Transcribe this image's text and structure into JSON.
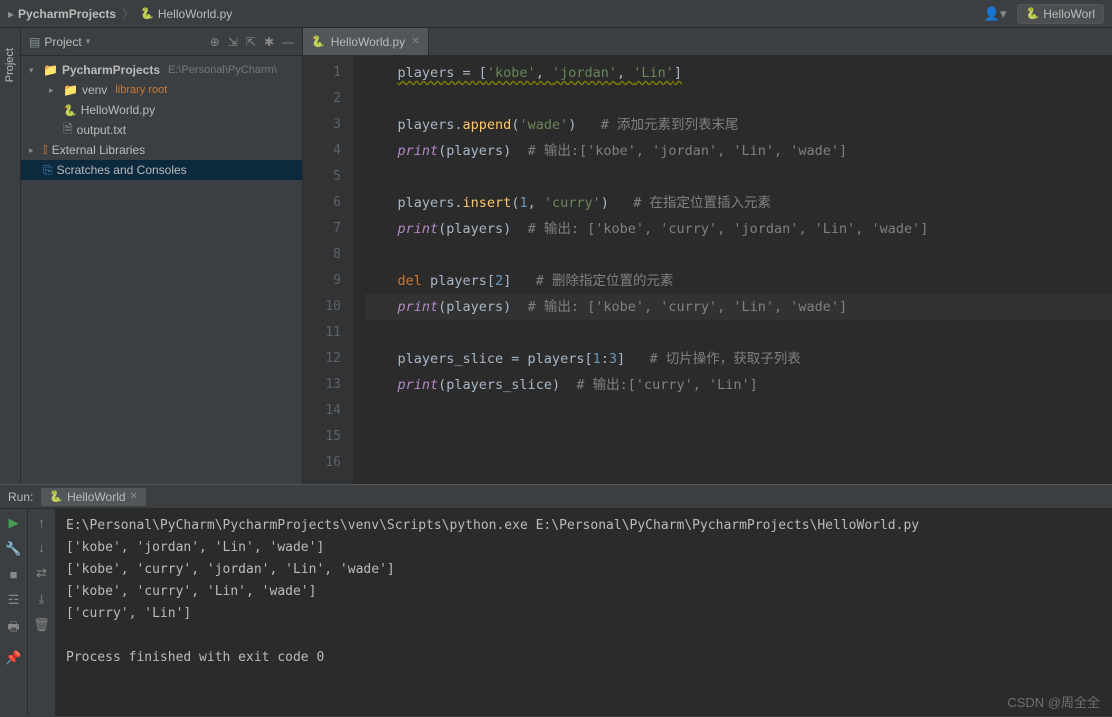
{
  "breadcrumb": {
    "project": "PycharmProjects",
    "file": "HelloWorld.py"
  },
  "top_right": {
    "run_config": "HelloWorl"
  },
  "project_panel": {
    "title": "Project",
    "root": {
      "name": "PycharmProjects",
      "path": "E:\\Personal\\PyCharm\\"
    },
    "venv": {
      "name": "venv",
      "tag": "library root"
    },
    "files": [
      "HelloWorld.py",
      "output.txt"
    ],
    "external": "External Libraries",
    "scratches": "Scratches and Consoles"
  },
  "editor": {
    "tab": "HelloWorld.py",
    "lines": [
      {
        "n": 1,
        "tokens": [
          [
            "",
            "players = ["
          ],
          [
            "s",
            "'kobe'"
          ],
          [
            "",
            ", "
          ],
          [
            "s",
            "'jordan'"
          ],
          [
            "",
            ", "
          ],
          [
            "s",
            "'Lin'"
          ],
          [
            "",
            "]"
          ]
        ],
        "wavy": true
      },
      {
        "n": 2,
        "tokens": []
      },
      {
        "n": 3,
        "tokens": [
          [
            "",
            "players."
          ],
          [
            "f",
            "append"
          ],
          [
            "",
            "("
          ],
          [
            "s",
            "'wade'"
          ],
          [
            "",
            ")   "
          ],
          [
            "c",
            "# 添加元素到列表末尾"
          ]
        ]
      },
      {
        "n": 4,
        "tokens": [
          [
            "fi",
            "print"
          ],
          [
            "",
            "(players)  "
          ],
          [
            "c",
            "# 输出:['kobe', 'jordan', 'Lin', 'wade']"
          ]
        ]
      },
      {
        "n": 5,
        "tokens": []
      },
      {
        "n": 6,
        "tokens": [
          [
            "",
            "players."
          ],
          [
            "f",
            "insert"
          ],
          [
            "",
            "("
          ],
          [
            "n",
            "1"
          ],
          [
            "",
            ", "
          ],
          [
            "s",
            "'curry'"
          ],
          [
            "",
            ")   "
          ],
          [
            "c",
            "# 在指定位置插入元素"
          ]
        ]
      },
      {
        "n": 7,
        "tokens": [
          [
            "fi",
            "print"
          ],
          [
            "",
            "(players)  "
          ],
          [
            "c",
            "# 输出: ['kobe', 'curry', 'jordan', 'Lin', 'wade']"
          ]
        ]
      },
      {
        "n": 8,
        "tokens": []
      },
      {
        "n": 9,
        "tokens": [
          [
            "k",
            "del "
          ],
          [
            "",
            "players["
          ],
          [
            "n",
            "2"
          ],
          [
            "",
            "]   "
          ],
          [
            "c",
            "# 删除指定位置的元素"
          ]
        ]
      },
      {
        "n": 10,
        "tokens": [
          [
            "fi",
            "print"
          ],
          [
            "",
            "(players)  "
          ],
          [
            "c",
            "# 输出: ['kobe', 'curry', 'Lin', 'wade']"
          ]
        ],
        "hl": true
      },
      {
        "n": 11,
        "tokens": []
      },
      {
        "n": 12,
        "tokens": [
          [
            "",
            "players_slice = players["
          ],
          [
            "n",
            "1"
          ],
          [
            "",
            ":"
          ],
          [
            "n",
            "3"
          ],
          [
            "",
            "]   "
          ],
          [
            "c",
            "# 切片操作，获取子列表"
          ]
        ]
      },
      {
        "n": 13,
        "tokens": [
          [
            "fi",
            "print"
          ],
          [
            "",
            "(players_slice)  "
          ],
          [
            "c",
            "# 输出:['curry', 'Lin']"
          ]
        ]
      },
      {
        "n": 14,
        "tokens": []
      },
      {
        "n": 15,
        "tokens": []
      },
      {
        "n": 16,
        "tokens": []
      }
    ]
  },
  "run": {
    "label": "Run:",
    "tab": "HelloWorld",
    "output": [
      "E:\\Personal\\PyCharm\\PycharmProjects\\venv\\Scripts\\python.exe E:\\Personal\\PyCharm\\PycharmProjects\\HelloWorld.py",
      "['kobe', 'jordan', 'Lin', 'wade']",
      "['kobe', 'curry', 'jordan', 'Lin', 'wade']",
      "['kobe', 'curry', 'Lin', 'wade']",
      "['curry', 'Lin']",
      "",
      "Process finished with exit code 0"
    ]
  },
  "watermark": "CSDN @周全全"
}
